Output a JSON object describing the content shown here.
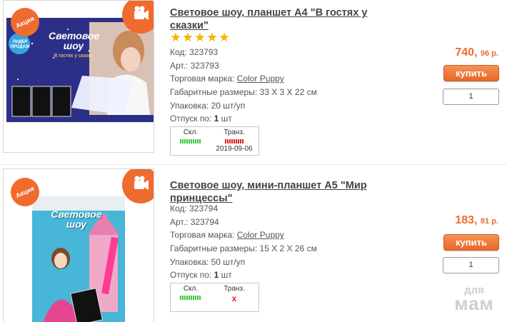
{
  "products": [
    {
      "title": "Световое шоу, планшет А4 \"В гостях у сказки\"",
      "image": {
        "badge_left": "Акция",
        "badge_right_icon": "camera-icon",
        "box_title": "Световое шоу",
        "box_subtitle": "В гостях у сказки",
        "sticker": "ЛИДЕР ПРОДАЖ"
      },
      "rating_stars": 5,
      "code_label": "Код:",
      "code": "323793",
      "art_label": "Арт.:",
      "art": "323793",
      "brand_label": "Торговая марка:",
      "brand": "Color Puppy",
      "dims_label": "Габаритные размеры:",
      "dims": "33 Х 3 Х 22 см",
      "pack_label": "Упаковка:",
      "pack": "20 шт/уп",
      "release_label": "Отпуск по:",
      "release_qty": "1",
      "release_unit": "шт",
      "stock": {
        "warehouse_label": "Скл.",
        "transit_label": "Транз.",
        "transit_date": "2019-09-06"
      },
      "price_main": "740,",
      "price_cents": "96 р.",
      "buy_label": "купить",
      "qty": "1"
    },
    {
      "title": "Световое шоу, мини-планшет А5 \"Мир принцессы\"",
      "image": {
        "badge_left": "Акция",
        "badge_right_icon": "camera-icon",
        "box_title": "Световое шоу"
      },
      "code_label": "Код:",
      "code": "323794",
      "art_label": "Арт.:",
      "art": "323794",
      "brand_label": "Торговая марка:",
      "brand": "Color Puppy",
      "dims_label": "Габаритные размеры:",
      "dims": "15 Х 2 Х 26 см",
      "pack_label": "Упаковка:",
      "pack": "50 шт/уп",
      "release_label": "Отпуск по:",
      "release_qty": "1",
      "release_unit": "шт",
      "stock": {
        "warehouse_label": "Скл.",
        "transit_label": "Транз.",
        "transit_value": "x"
      },
      "price_main": "183,",
      "price_cents": "81 р.",
      "buy_label": "купить",
      "qty": "1"
    }
  ],
  "watermark": {
    "line1": "для",
    "line2": "мам"
  },
  "colors": {
    "accent": "#ef6b2e",
    "star": "#f7b500",
    "stock_ok": "#3cc63c",
    "stock_bad": "#e02020"
  }
}
